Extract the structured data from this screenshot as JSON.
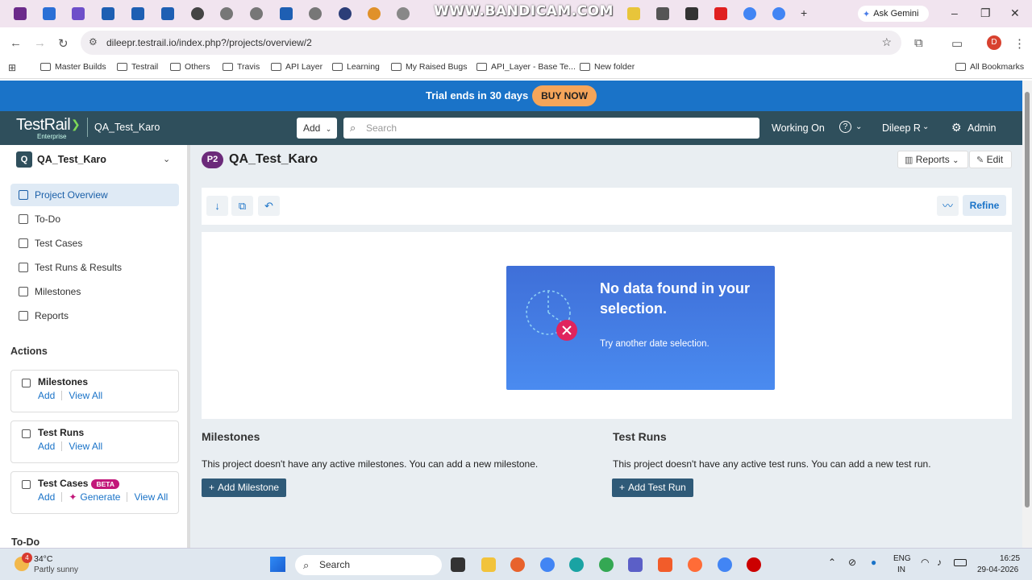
{
  "browser": {
    "watermark": "WWW.BANDICAM.COM",
    "gemini_label": "Ask Gemini",
    "url": "dileepr.testrail.io/index.php?/projects/overview/2",
    "profile_initial": "D",
    "bookmarks": [
      "Master Builds",
      "Testrail",
      "Others",
      "Travis",
      "API Layer",
      "Learning",
      "My Raised Bugs",
      "API_Layer - Base Te...",
      "New folder"
    ],
    "all_bookmarks": "All Bookmarks"
  },
  "trial": {
    "text": "Trial ends in 30 days",
    "button": "BUY NOW"
  },
  "header": {
    "logo": "TestRail",
    "logo_sub": "Enterprise",
    "project": "QA_Test_Karo",
    "add_label": "Add",
    "search_placeholder": "Search",
    "working_on": "Working On",
    "user": "Dileep R",
    "admin": "Admin"
  },
  "sidebar": {
    "project_badge": "Q",
    "project_name": "QA_Test_Karo",
    "nav": [
      {
        "label": "Project Overview"
      },
      {
        "label": "To-Do"
      },
      {
        "label": "Test Cases"
      },
      {
        "label": "Test Runs & Results"
      },
      {
        "label": "Milestones"
      },
      {
        "label": "Reports"
      }
    ],
    "actions_title": "Actions",
    "actions": {
      "milestones": {
        "title": "Milestones",
        "add": "Add",
        "view_all": "View All"
      },
      "test_runs": {
        "title": "Test Runs",
        "add": "Add",
        "view_all": "View All"
      },
      "test_cases": {
        "title": "Test Cases",
        "beta": "BETA",
        "add": "Add",
        "generate": "Generate",
        "view_all": "View All"
      }
    },
    "todo_title": "To-Do"
  },
  "main": {
    "project_code": "P2",
    "title": "QA_Test_Karo",
    "reports_label": "Reports",
    "edit_label": "Edit",
    "refine_label": "Refine",
    "nodata_title": "No data found in your selection.",
    "nodata_sub": "Try another date selection.",
    "milestones": {
      "title": "Milestones",
      "text": "This project doesn't have any active milestones. You can add a new milestone.",
      "button": "Add Milestone"
    },
    "test_runs": {
      "title": "Test Runs",
      "text": "This project doesn't have any active test runs. You can add a new test run.",
      "button": "Add Test Run"
    }
  },
  "taskbar": {
    "weather_temp": "34°C",
    "weather_desc": "Partly sunny",
    "weather_badge": "4",
    "search_label": "Search",
    "lang1": "ENG",
    "lang2": "IN",
    "time": "16:25",
    "date": "29-04-2026"
  }
}
